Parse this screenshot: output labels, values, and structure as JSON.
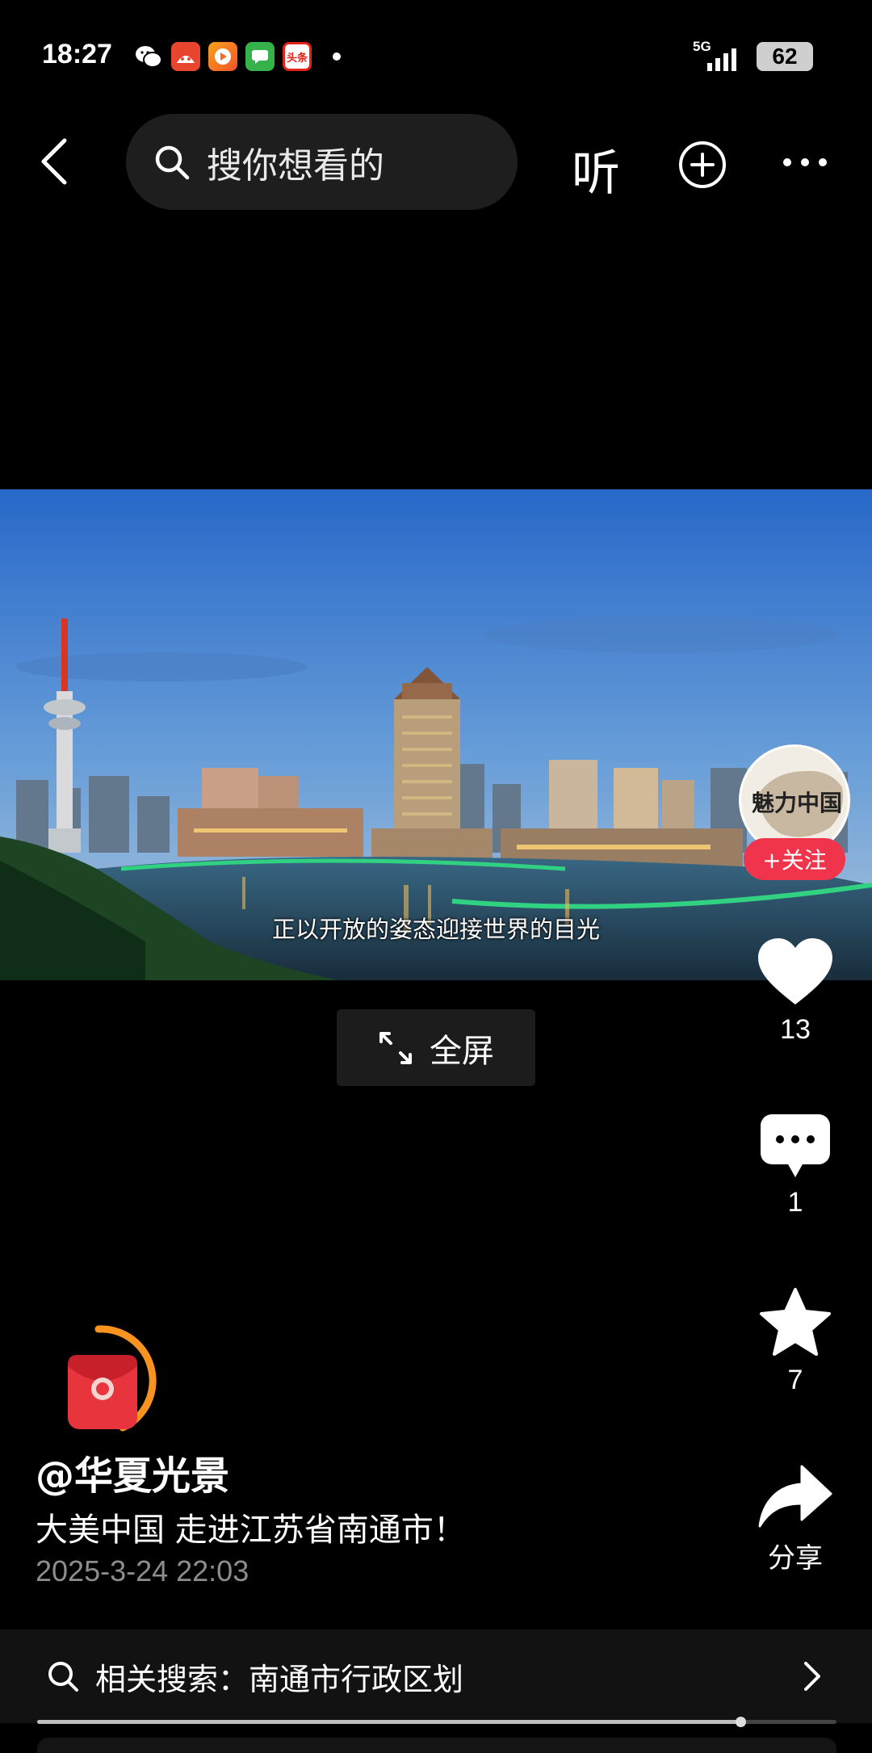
{
  "status_bar": {
    "time": "18:27",
    "network": "5G",
    "battery": "62",
    "notification_apps": [
      {
        "name": "wechat-icon",
        "label": "",
        "color": "#000000"
      },
      {
        "name": "app-red-icon",
        "label": "",
        "color": "#e8452e"
      },
      {
        "name": "video-app-icon",
        "label": "",
        "color": "#f26d21"
      },
      {
        "name": "message-app-icon",
        "label": "",
        "color": "#35b34a"
      },
      {
        "name": "toutiao-icon",
        "label": "头条",
        "color": "#e2231a"
      }
    ]
  },
  "header": {
    "search_placeholder": "搜你想看的",
    "listen_label": "听"
  },
  "video": {
    "subtitle": "正以开放的姿态迎接世界的目光",
    "fullscreen_label": "全屏"
  },
  "creator": {
    "avatar_text": "魅力中国",
    "follow_label": "+关注"
  },
  "actions": {
    "likes": "13",
    "comments": "1",
    "favorites": "7",
    "share_label": "分享"
  },
  "post": {
    "author": "@华夏光景",
    "description": "大美中国 走进江苏省南通市！",
    "date": "2025-3-24 22:03"
  },
  "related_search": {
    "text": "相关搜索：南通市行政区划"
  },
  "playback": {
    "progress": 0.88
  },
  "colors": {
    "follow_red": "#f0344b",
    "redpack_red": "#e8343d",
    "redpack_ring": "#f7931e"
  }
}
